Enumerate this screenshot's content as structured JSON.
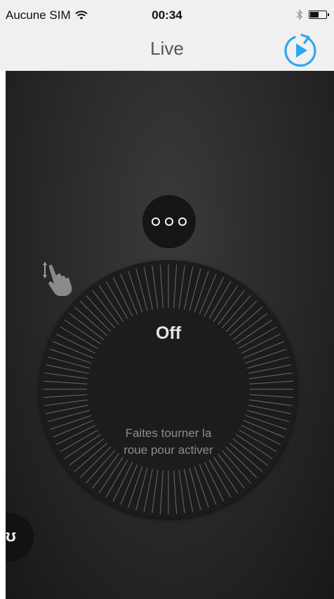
{
  "status_bar": {
    "carrier": "Aucune SIM",
    "time": "00:34",
    "wifi_icon": "wifi-icon",
    "bluetooth_icon": "bluetooth-icon",
    "battery_icon": "battery-icon",
    "battery_level": 0.5
  },
  "nav_bar": {
    "title": "Live",
    "replay_icon": "replay-play-icon",
    "accent_color": "#2aa8f2"
  },
  "main": {
    "more_icon": "more-dots-icon",
    "dial": {
      "status": "Off",
      "gesture_icon": "rotate-hand-icon",
      "hint_line1": "Faites tourner la",
      "hint_line2": "roue pour activer"
    },
    "corner_glyph": "ʊ"
  }
}
